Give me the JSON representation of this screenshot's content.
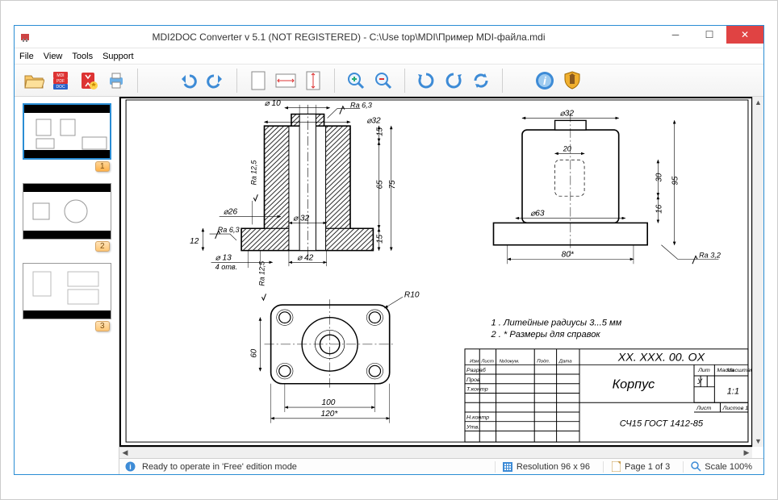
{
  "title": "MDI2DOC Converter v 5.1   (NOT REGISTERED)  -  C:\\Use                top\\MDI\\Пример MDI-файла.mdi",
  "menu": {
    "file": "File",
    "view": "View",
    "tools": "Tools",
    "support": "Support"
  },
  "toolbar": {
    "open": "open",
    "convert": "convert",
    "wizard": "wizard",
    "print": "print",
    "undo": "undo",
    "redo": "redo",
    "fitpage": "fit-page",
    "fitwidth": "fit-width",
    "fitheight": "fit-height",
    "zoomin": "zoom-in",
    "zoomout": "zoom-out",
    "rotl": "rotate-left",
    "rotr": "rotate-right",
    "refresh": "refresh",
    "info": "info",
    "register": "register"
  },
  "thumbs": {
    "p1": "1",
    "p2": "2",
    "p3": "3"
  },
  "status": {
    "ready": "Ready to operate in 'Free' edition mode",
    "res": "Resolution 96 x 96",
    "page": "Page 1 of 3",
    "scale": "Scale 100%"
  },
  "drawing": {
    "d10": "⌀ 10",
    "ra63": "Ra 6,3",
    "d32": "⌀32",
    "h75": "75",
    "h15t": "15",
    "h65": "65",
    "h15b": "15",
    "d26": "⌀26",
    "d32b": "⌀ 32",
    "ra63l": "Ra 6,3",
    "h12": "12",
    "d13": "⌀ 13",
    "holes": "4 отв.",
    "d42": "⌀ 42",
    "ra125": "Ra 12,5",
    "ra125b": "Ra 12,5",
    "r10": "R10",
    "w100": "100",
    "w120": "120*",
    "h60": "60",
    "d32r": "⌀32",
    "w20": "20",
    "d63": "⌀63",
    "h95": "95",
    "h30": "30",
    "h16": "16",
    "w80": "80*",
    "ra32": "Ra 3,2",
    "note1": "1 . Литейные радиусы 3...5 мм",
    "note2": "2 . * Размеры для справок",
    "dwgno": "XX. XXX. 00. OX",
    "part": "Корпус",
    "mat": "СЧ15  ГОСТ  1412-85",
    "scale11": "1:1",
    "lit": "У",
    "h_im": "Изм",
    "h_list": "Лист",
    "h_doc": "№докум.",
    "h_pod": "Подп.",
    "h_data": "Дата",
    "r_raz": "Разраб",
    "r_prov": "Пров",
    "r_tk": "Т.контр",
    "r_nk": "Н.контр",
    "r_utv": "Утв.",
    "c_lit": "Лит",
    "c_mass": "Масса",
    "c_scale": "Масштаб",
    "c_list": "Лист",
    "c_listov": "Листов 1"
  }
}
